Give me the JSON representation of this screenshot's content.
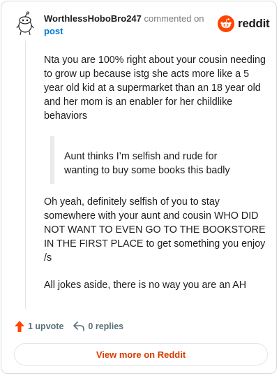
{
  "comment": {
    "username": "WorthlessHoboBro247",
    "action_text": "commented on",
    "post_link": "post",
    "paragraphs": [
      "Nta you are 100% right about your cousin needing to grow up because istg she acts more like a 5 year old kid at a supermarket than an 18 year old and her mom is an enabler for her childlike behaviors",
      "Oh yeah, definitely selfish of you to stay somewhere with your aunt and cousin WHO DID NOT WANT TO EVEN GO TO THE BOOKSTORE IN THE FIRST PLACE to get something you enjoy /s",
      "All jokes aside, there is no way you are an AH"
    ],
    "quote": "Aunt thinks I’m selfish and rude for wanting to buy some books this badly"
  },
  "brand": {
    "name": "reddit",
    "logo_icon": "reddit-snoo-icon",
    "accent": "#ff4500"
  },
  "footer": {
    "upvote_label": "1 upvote",
    "upvote_icon": "upvote-arrow-icon",
    "reply_label": "0 replies",
    "reply_icon": "reply-arrow-icon"
  },
  "view_more_label": "View more on Reddit",
  "colors": {
    "link": "#0079d3",
    "view_more": "#d93a00",
    "muted": "#576f76"
  }
}
